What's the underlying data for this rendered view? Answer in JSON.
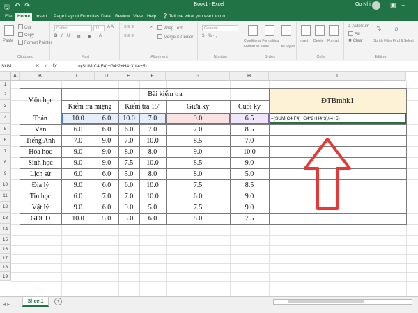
{
  "app": {
    "doc_title": "Book1 - Excel",
    "user_name": "Oo Nhi",
    "accent": "#217346"
  },
  "quick_access": [
    "save-icon",
    "undo-icon",
    "redo-icon"
  ],
  "ribbon_tabs": [
    "File",
    "Home",
    "Insert",
    "Page Layout",
    "Formulas",
    "Data",
    "Review",
    "View",
    "Help",
    "Tell me what you want to do"
  ],
  "ribbon": {
    "clipboard": {
      "paste": "Paste",
      "cut": "Cut",
      "copy": "Copy",
      "format_painter": "Format Painter",
      "label": "Clipboard"
    },
    "font": {
      "name": "Calibri",
      "size": "11",
      "label": "Font"
    },
    "alignment": {
      "wrap": "Wrap Text",
      "merge": "Merge & Center",
      "label": "Alignment"
    },
    "number": {
      "format": "General",
      "label": "Number"
    },
    "styles": {
      "conditional": "Conditional Formatting",
      "format_table": "Format as Table",
      "cell_styles": "Cell Styles",
      "label": "Styles"
    },
    "cells": {
      "insert": "Insert",
      "delete": "Delete",
      "format": "Format",
      "label": "Cells"
    },
    "editing": {
      "autosum": "AutoSum",
      "fill": "Fill",
      "clear": "Clear",
      "sort": "Sort & Filter",
      "find": "Find & Select",
      "label": "Editing"
    }
  },
  "formula_bar": {
    "name_box": "SUM",
    "formula": "=(SUM(C4:F4)+G4*2+H4*3)/(4+5)"
  },
  "columns": [
    "A",
    "B",
    "C",
    "D",
    "E",
    "F",
    "G",
    "H",
    "I"
  ],
  "rows": [
    "1",
    "2",
    "3",
    "4",
    "5",
    "6",
    "7",
    "8",
    "9",
    "10",
    "11",
    "12",
    "13",
    "14",
    "15",
    "16",
    "17",
    "18",
    "19"
  ],
  "table": {
    "mon_hoc": "Môn học",
    "bai_kiem_tra": "Bài kiểm tra",
    "kiem_tra_mieng": "Kiểm tra miệng",
    "kiem_tra_15": "Kiểm tra 15'",
    "giua_ky": "Giữa kỳ",
    "cuoi_ky": "Cuối kỳ",
    "dtbmhk1": "ĐTBmhk1",
    "active_formula": "=(SUM(C4:F4)+G4*2+H4*3)/(4+5)",
    "data": [
      [
        "Toán",
        "10.0",
        "6.0",
        "10.0",
        "7.0",
        "9.0",
        "6.5"
      ],
      [
        "Văn",
        "6.0",
        "6.0",
        "6.0",
        "7.0",
        "7.0",
        "8.5"
      ],
      [
        "Tiếng Anh",
        "7.0",
        "9.0",
        "7.0",
        "10.0",
        "8.5",
        "7.0"
      ],
      [
        "Hóa học",
        "9.0",
        "9.0",
        "8.0",
        "8.0",
        "9.0",
        "10.0"
      ],
      [
        "Sinh học",
        "9.0",
        "9.0",
        "7.5",
        "10.0",
        "8.5",
        "9.0"
      ],
      [
        "Lịch sử",
        "6.0",
        "6.0",
        "5.0",
        "8.0",
        "8.0",
        "5.0"
      ],
      [
        "Địa lý",
        "9.0",
        "6.0",
        "6.0",
        "10.0",
        "7.5",
        "8.5"
      ],
      [
        "Tin học",
        "6.0",
        "7.0",
        "7.0",
        "10.0",
        "6.0",
        "9.0"
      ],
      [
        "Vật lý",
        "9.0",
        "6.0",
        "9.0",
        "5.0",
        "7.5",
        "9.0"
      ],
      [
        "GDCD",
        "10.0",
        "5.0",
        "5.0",
        "6.0",
        "8.0",
        "7.5"
      ]
    ]
  },
  "sheet_tabs": [
    "Sheet1"
  ],
  "annotation": {
    "arrow_color": "#e53935",
    "icon": "arrow-up-icon"
  }
}
